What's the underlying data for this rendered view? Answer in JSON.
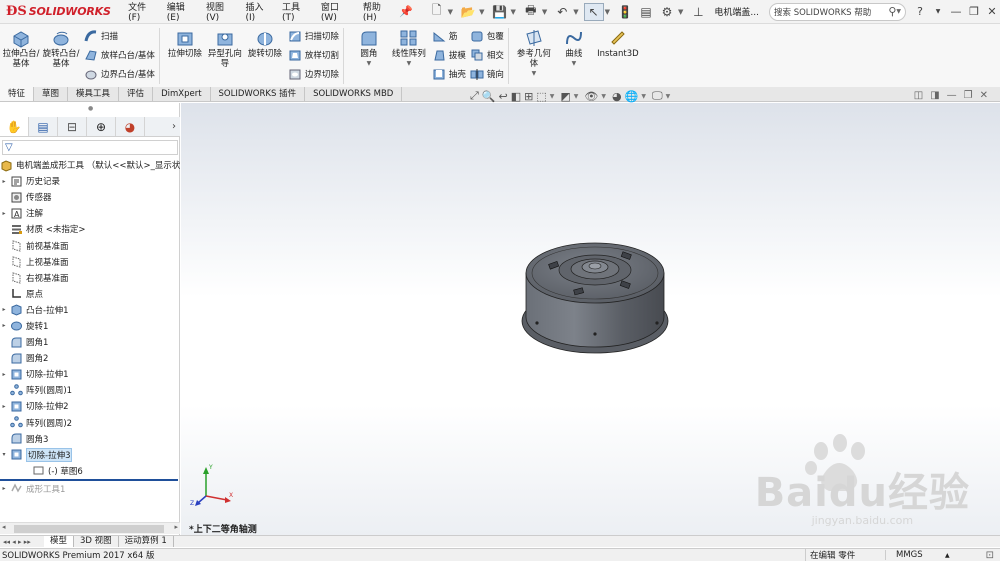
{
  "app": {
    "logo_mark": "ƉS",
    "logo_text": "SOLIDWORKS",
    "menu": [
      "文件(F)",
      "编辑(E)",
      "视图(V)",
      "插入(I)",
      "工具(T)",
      "窗口(W)",
      "帮助(H)"
    ],
    "doc_title": "电机端盖...",
    "search_placeholder": "搜索 SOLIDWORKS 帮助",
    "help": "?"
  },
  "ribbon": {
    "extrude_boss": "拉伸凸台/基体",
    "revolve_boss": "旋转凸台/基体",
    "sweep": "扫描",
    "loft_boss": "放样凸台/基体",
    "boundary_boss": "边界凸台/基体",
    "extrude_cut": "拉伸切除",
    "hole_wizard": "异型孔向导",
    "revolve_cut": "旋转切除",
    "sweep_cut": "扫描切除",
    "loft_cut": "放样切割",
    "boundary_cut": "边界切除",
    "fillet": "圆角",
    "linear_pattern": "线性阵列",
    "rib": "筋",
    "draft": "拔模",
    "shell": "抽壳",
    "wrap": "包覆",
    "intersect": "相交",
    "mirror": "镜向",
    "ref_geometry": "参考几何体",
    "curves": "曲线",
    "instant3d": "Instant3D"
  },
  "command_tabs": [
    "特征",
    "草图",
    "模具工具",
    "评估",
    "DimXpert",
    "SOLIDWORKS 插件",
    "SOLIDWORKS MBD"
  ],
  "feature_tree": {
    "root": "电机端盖成形工具 （默认<<默认>_显示状",
    "nodes": [
      {
        "label": "历史记录",
        "icon": "history",
        "exp": "▸"
      },
      {
        "label": "传感器",
        "icon": "sensor",
        "exp": ""
      },
      {
        "label": "注解",
        "icon": "annotation",
        "exp": "▸"
      },
      {
        "label": "材质 <未指定>",
        "icon": "material",
        "exp": ""
      },
      {
        "label": "前视基准面",
        "icon": "plane",
        "exp": ""
      },
      {
        "label": "上视基准面",
        "icon": "plane",
        "exp": ""
      },
      {
        "label": "右视基准面",
        "icon": "plane",
        "exp": ""
      },
      {
        "label": "原点",
        "icon": "origin",
        "exp": ""
      },
      {
        "label": "凸台-拉伸1",
        "icon": "extrude",
        "exp": "▸"
      },
      {
        "label": "旋转1",
        "icon": "revolve",
        "exp": "▸"
      },
      {
        "label": "圆角1",
        "icon": "fillet",
        "exp": ""
      },
      {
        "label": "圆角2",
        "icon": "fillet",
        "exp": ""
      },
      {
        "label": "切除-拉伸1",
        "icon": "cut",
        "exp": "▸"
      },
      {
        "label": "阵列(圆周)1",
        "icon": "pattern",
        "exp": ""
      },
      {
        "label": "切除-拉伸2",
        "icon": "cut",
        "exp": "▸"
      },
      {
        "label": "阵列(圆周)2",
        "icon": "pattern",
        "exp": ""
      },
      {
        "label": "圆角3",
        "icon": "fillet",
        "exp": ""
      },
      {
        "label": "切除-拉伸3",
        "icon": "cut",
        "exp": "▾"
      },
      {
        "label": "(-) 草图6",
        "icon": "sketch",
        "exp": ""
      },
      {
        "label": "成形工具1",
        "icon": "formtool",
        "exp": "▸"
      }
    ],
    "selected_index": 17,
    "rolled_back_index": 19
  },
  "bottom_tabs": [
    "模型",
    "3D 视图",
    "运动算例 1"
  ],
  "viewport": {
    "view_label": "*上下二等角轴测",
    "model_color": "#55595f"
  },
  "status": {
    "app": "SOLIDWORKS Premium 2017 x64 版",
    "mode": "在编辑 零件",
    "units": "MMGS"
  },
  "watermark": {
    "main": "Baidu经验",
    "url": "jingyan.baidu.com"
  }
}
